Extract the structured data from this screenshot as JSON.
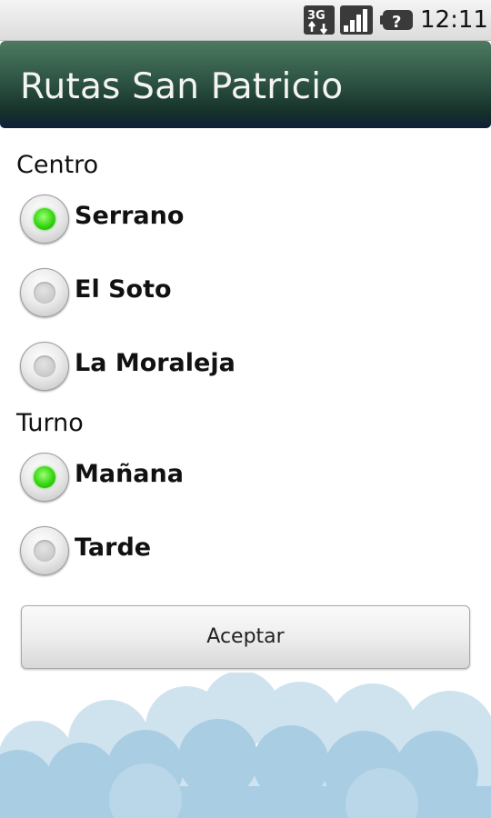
{
  "status_bar": {
    "network_icon": "3g-data-icon",
    "signal_icon": "signal-strength-icon",
    "battery_icon": "battery-unknown-icon",
    "time": "12:11"
  },
  "app": {
    "title": "Rutas San Patricio"
  },
  "centro": {
    "label": "Centro",
    "options": [
      {
        "label": "Serrano",
        "checked": true
      },
      {
        "label": "El Soto",
        "checked": false
      },
      {
        "label": "La Moraleja",
        "checked": false
      }
    ]
  },
  "turno": {
    "label": "Turno",
    "options": [
      {
        "label": "Mañana",
        "checked": true
      },
      {
        "label": "Tarde",
        "checked": false
      }
    ]
  },
  "accept_button": {
    "label": "Aceptar"
  },
  "colors": {
    "title_bar_top": "#4d7a60",
    "title_bar_bottom": "#0e2038",
    "radio_checked": "#36d611",
    "cloud_blue": "#a9cde2"
  }
}
